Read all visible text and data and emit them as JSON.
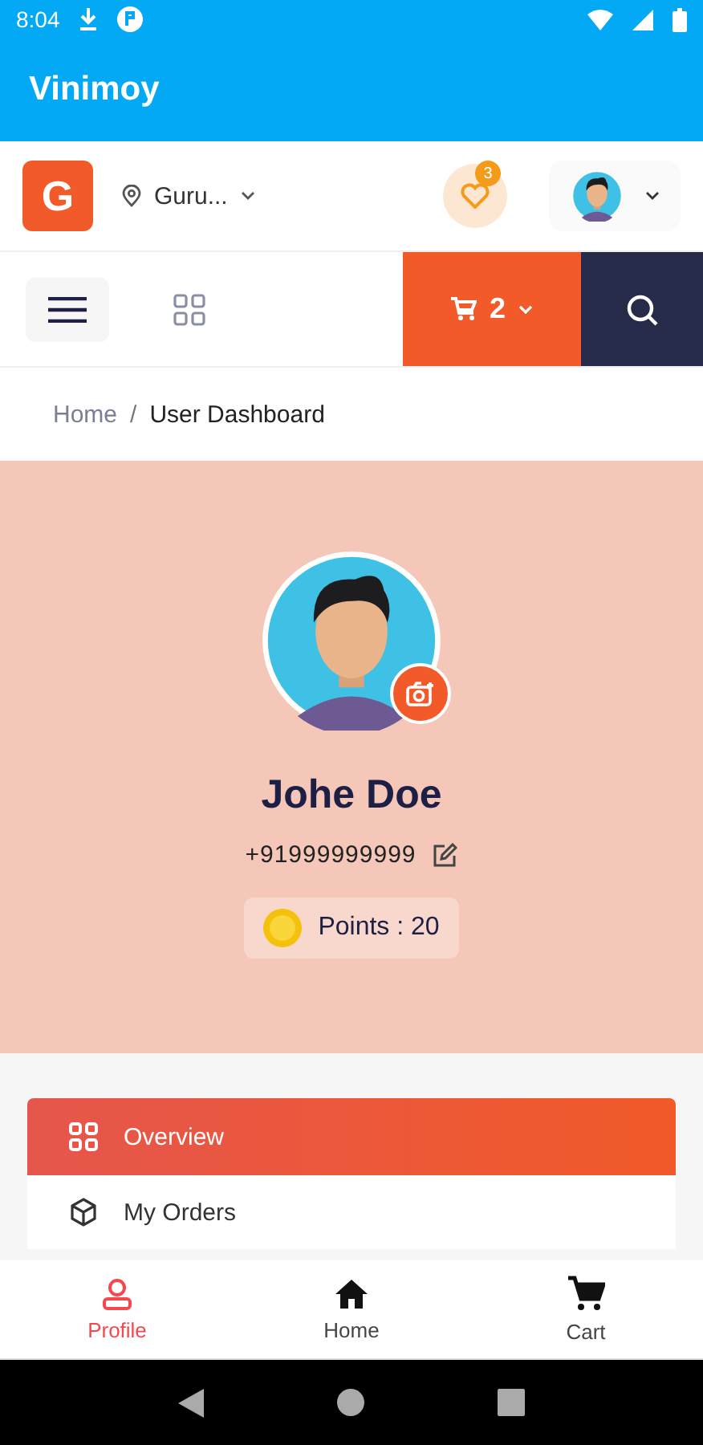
{
  "status_bar": {
    "time": "8:04"
  },
  "app_bar": {
    "title": "Vinimoy"
  },
  "header": {
    "logo": "G",
    "location": "Guru...",
    "wishlist_count": "3"
  },
  "toolbar": {
    "cart_count": "2"
  },
  "breadcrumb_separator": "/",
  "breadcrumb": [
    {
      "label": "Home",
      "current": false
    },
    {
      "label": "User Dashboard",
      "current": true
    }
  ],
  "profile": {
    "name": "Johe Doe",
    "phone": "+91999999999",
    "points": "Points : 20"
  },
  "menu": [
    {
      "label": "Overview",
      "kind": "grid",
      "selected": true
    },
    {
      "label": "My Orders",
      "kind": "box",
      "selected": false
    }
  ],
  "bottom_nav": [
    {
      "label": "Profile",
      "kind": "profile",
      "selected": true
    },
    {
      "label": "Home",
      "kind": "home",
      "selected": false
    },
    {
      "label": "Cart",
      "kind": "cart",
      "selected": false
    }
  ]
}
